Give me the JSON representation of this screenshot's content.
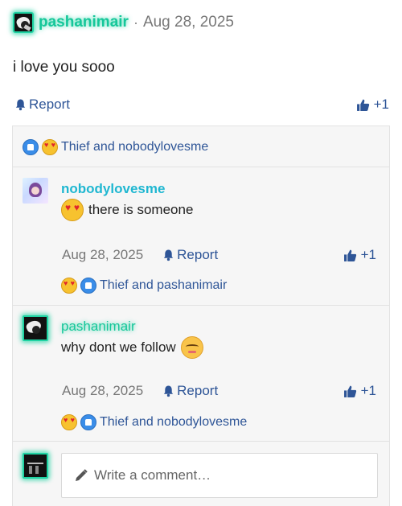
{
  "post": {
    "author": "pashanimair",
    "separator": "·",
    "date": "Aug 28, 2025",
    "body": "i love you sooo",
    "report_label": "Report",
    "like_label": "+1"
  },
  "reactions_summary": {
    "text": "Thief and nobodylovesme",
    "icons": [
      "like-icon",
      "heart-eyes-icon"
    ]
  },
  "comments": [
    {
      "author": "nobodylovesme",
      "text": "there is someone",
      "date": "Aug 28, 2025",
      "report_label": "Report",
      "like_label": "+1",
      "reactions_text": "Thief and pashanimair"
    },
    {
      "author": "pashanimair",
      "text": "why dont we follow",
      "date": "Aug 28, 2025",
      "report_label": "Report",
      "like_label": "+1",
      "reactions_text": "Thief and nobodylovesme"
    }
  ],
  "composer": {
    "placeholder": "Write a comment…"
  },
  "colors": {
    "accent": "#2e5597",
    "glow": "#1fd3a3",
    "cyan_name": "#1fb7d1"
  }
}
